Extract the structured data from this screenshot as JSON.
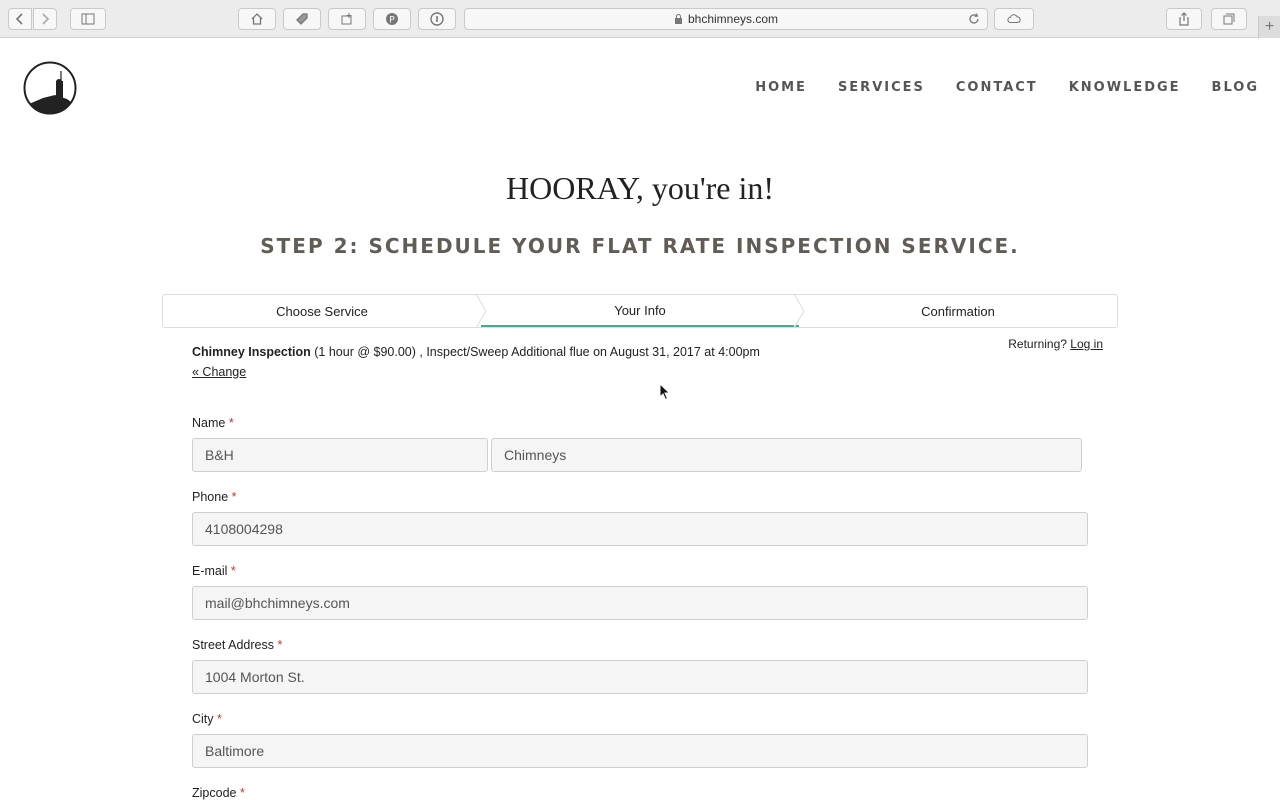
{
  "browser": {
    "url": "bhchimneys.com"
  },
  "nav": {
    "items": [
      "HOME",
      "SERVICES",
      "CONTACT",
      "KNOWLEDGE",
      "BLOG"
    ]
  },
  "hero": {
    "title": "HOORAY, you're in!",
    "step": "STEP 2: SCHEDULE YOUR FLAT RATE INSPECTION SERVICE."
  },
  "stepper": {
    "steps": [
      "Choose Service",
      "Your Info",
      "Confirmation"
    ],
    "active": "Your Info"
  },
  "booking": {
    "service": "Chimney Inspection",
    "details": "(1 hour @ $90.00) , Inspect/Sweep Additional flue on August 31, 2017 at 4:00pm",
    "change_label": "« Change",
    "returning_label": "Returning?",
    "login_label": "Log in"
  },
  "form": {
    "name_label": "Name",
    "first_name": "B&H",
    "last_name": "Chimneys",
    "phone_label": "Phone",
    "phone": "4108004298",
    "email_label": "E-mail",
    "email": "mail@bhchimneys.com",
    "street_label": "Street Address",
    "street": "1004 Morton St.",
    "city_label": "City",
    "city": "Baltimore",
    "zip_label": "Zipcode",
    "required_mark": "*"
  },
  "colors": {
    "accent": "#4aa7a0",
    "step_title": "#625c56",
    "required": "#c0392b"
  }
}
